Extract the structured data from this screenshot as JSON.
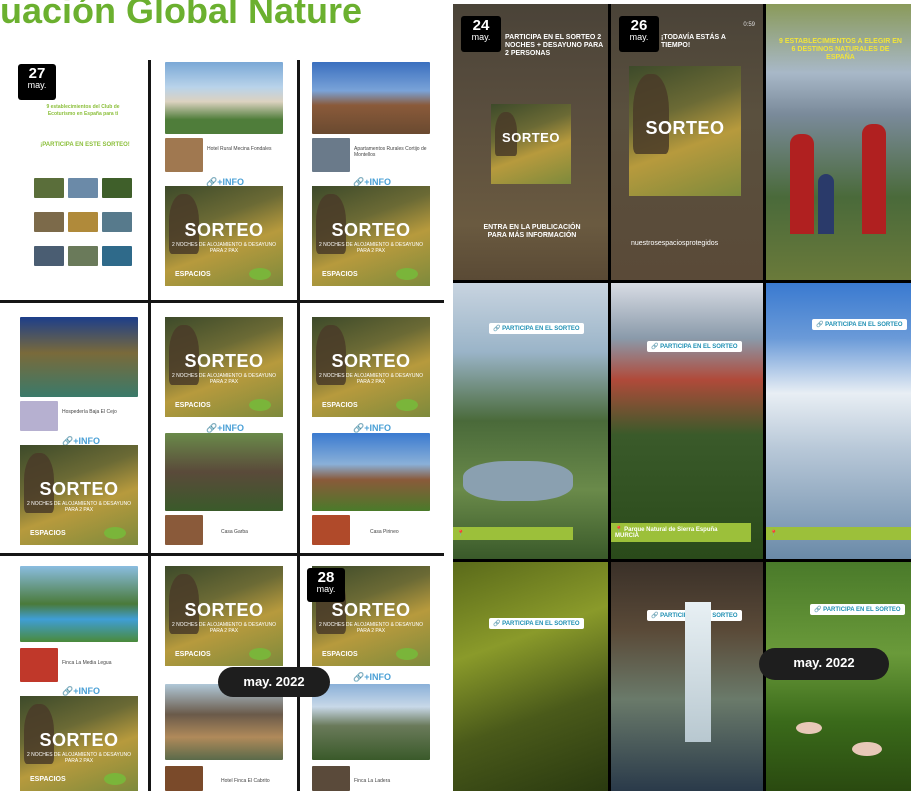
{
  "header": {
    "title": "uación Global Nature"
  },
  "left_grid": {
    "date_badge": {
      "day": "27",
      "month": "may."
    },
    "intro_text": "9 establecimientos del Club de Ecoturismo en España para ti",
    "intro_cta": "¡PARTICIPA EN ESTE SORTEO!",
    "sorteo_word": "SORTEO",
    "sorteo_sub": "2 NOCHES DE ALOJAMIENTO & DESAYUNO PARA 2 PAX",
    "logo_text": "ESPACIOS",
    "info_label": "+INFO",
    "captions": [
      "Hotel Rural Mecina Fondales",
      "Apartamentos Rurales Cortijo de Montellos",
      "Hospedería Baja El Cejo",
      "Casa Garba",
      "Casa Pirineo",
      "Finca La Media Legua",
      "Hotel Finca El Cabrito",
      "Finca La Ladera"
    ],
    "date_badge_2": {
      "day": "28",
      "month": "may."
    },
    "month_pill": "may. 2022"
  },
  "right_grid": {
    "story_1": {
      "day": "24",
      "month": "may.",
      "text": "PARTICIPA EN EL SORTEO 2 NOCHES + DESAYUNO PARA 2 PERSONAS",
      "footer": "ENTRA EN LA PUBLICACIÓN PARA MÁS INFORMACIÓN"
    },
    "story_2": {
      "day": "26",
      "month": "may.",
      "text": "¡TODAVÍA ESTÁS A TIEMPO!",
      "footer": "nuestrosespaciosprotegidos",
      "timer": "0:59"
    },
    "story_3": {
      "text": "9 ESTABLECIMIENTOS A ELEGIR EN 6 DESTINOS NATURALES DE ESPAÑA"
    },
    "participa_label": "PARTICIPA EN EL SORTEO",
    "locations": [
      "Parque Natural de Sierra Espuña",
      "MURCIA"
    ],
    "month_pill": "may. 2022"
  },
  "colors": {
    "accent_green": "#6bb02f",
    "info_blue": "#4aa0d6",
    "badge_black": "#000000"
  }
}
